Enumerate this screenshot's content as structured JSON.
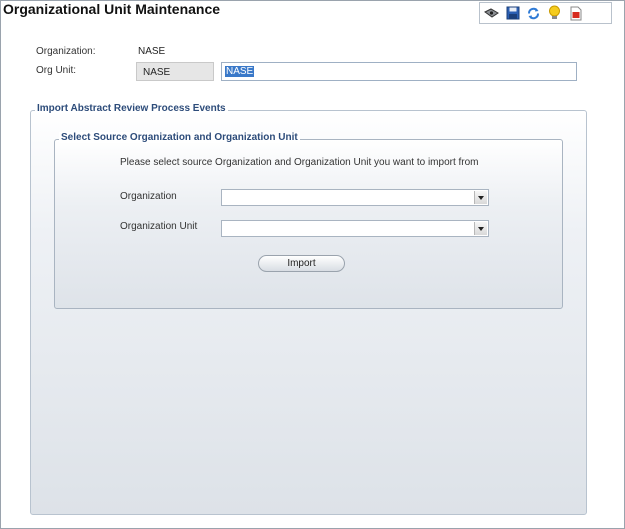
{
  "page": {
    "title": "Organizational Unit Maintenance"
  },
  "toolbar": {
    "icons": [
      "view-icon",
      "save-icon",
      "refresh-icon",
      "tip-icon",
      "pdf-report-icon"
    ]
  },
  "org_info": {
    "organization_label": "Organization:",
    "organization_value": "NASE",
    "org_unit_label": "Org Unit:",
    "org_unit_code": "NASE",
    "org_unit_name": "NASE"
  },
  "import_section": {
    "title": "Import Abstract Review Process Events",
    "source_panel": {
      "title": "Select Source Organization and Organization Unit",
      "hint": "Please select source Organization and Organization Unit you want to import from",
      "organization_label": "Organization",
      "organization_value": "",
      "org_unit_label": "Organization Unit",
      "org_unit_value": "",
      "import_label": "Import"
    }
  },
  "colors": {
    "legend_text": "#2d4c7a",
    "selection": "#3a79c9",
    "panel_border": "#b8c3cf"
  }
}
